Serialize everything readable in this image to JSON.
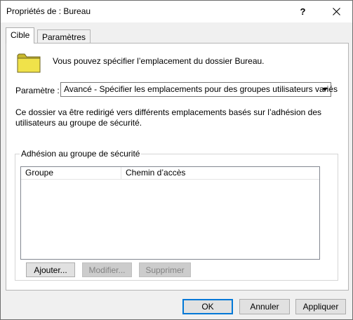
{
  "window": {
    "title": "Propriétés de : Bureau",
    "help_glyph": "?"
  },
  "tabs": [
    {
      "label": "Cible",
      "active": true
    },
    {
      "label": "Paramètres",
      "active": false
    }
  ],
  "target": {
    "intro": "Vous pouvez spécifier l’emplacement du dossier Bureau.",
    "setting_label": "Paramètre :",
    "setting_value": "Avancé - Spécifier les emplacements pour des groupes utilisateurs variés",
    "description": "Ce dossier va être redirigé vers différents emplacements basés sur l’adhésion des utilisateurs au groupe de sécurité.",
    "group_box_label": "Adhésion au groupe de sécurité",
    "columns": [
      "Groupe",
      "Chemin d’accès"
    ],
    "rows": [],
    "buttons": {
      "add": "Ajouter...",
      "modify": "Modifier...",
      "delete": "Supprimer"
    }
  },
  "footer": {
    "ok": "OK",
    "cancel": "Annuler",
    "apply": "Appliquer"
  },
  "colors": {
    "folder": "#f0e24a",
    "focus": "#0078d7"
  },
  "icons": {
    "folder": "folder-icon",
    "close": "close-icon",
    "dropdown": "chevron-down-icon"
  }
}
